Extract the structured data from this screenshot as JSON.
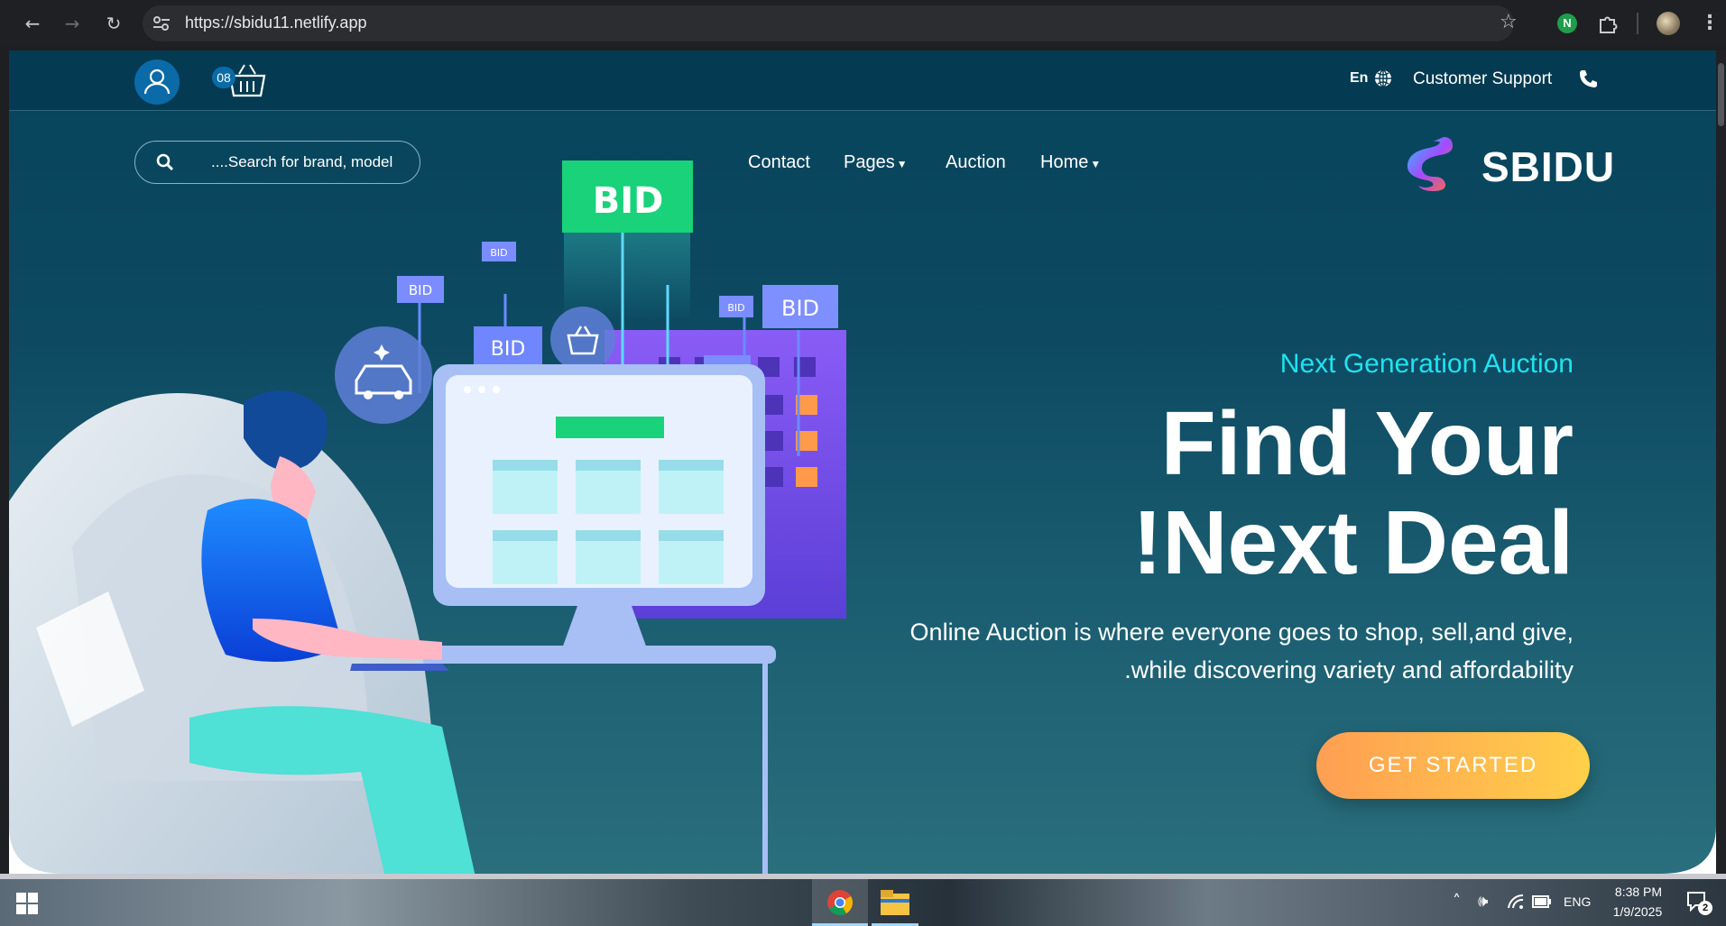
{
  "browser": {
    "url": "https://sbidu11.netlify.app",
    "icons": [
      "back-icon",
      "forward-icon",
      "reload-icon",
      "site-info-icon",
      "star-icon",
      "extension-n-icon",
      "extensions-icon",
      "profile-avatar",
      "menu-dots-icon"
    ]
  },
  "topbar": {
    "cart_count": "08",
    "language": "En",
    "support_label": "Customer Support"
  },
  "nav": {
    "search_placeholder": "....Search for brand, model",
    "items": [
      "Contact",
      "Pages",
      "Auction",
      "Home"
    ],
    "logo_text": "SBIDU"
  },
  "hero": {
    "kicker": "Next Generation Auction",
    "title_line1": "Find Your",
    "title_line2": "!Next Deal",
    "desc_line1": "Online Auction is where everyone goes to shop, sell,and give,",
    "desc_line2": ".while discovering variety and affordability",
    "cta": "GET STARTED",
    "bid_labels": [
      "BID",
      "BID",
      "BID",
      "BID",
      "BID",
      "BID",
      "BID"
    ]
  },
  "taskbar": {
    "language": "ENG",
    "time": "8:38 PM",
    "date": "1/9/2025",
    "notifications": "2"
  },
  "colors": {
    "accent_cyan": "#1ee3f0",
    "cta_start": "#ff9e52",
    "cta_end": "#ffd04a",
    "topbar_bg": "#043b52",
    "bid_green": "#19d27a"
  }
}
